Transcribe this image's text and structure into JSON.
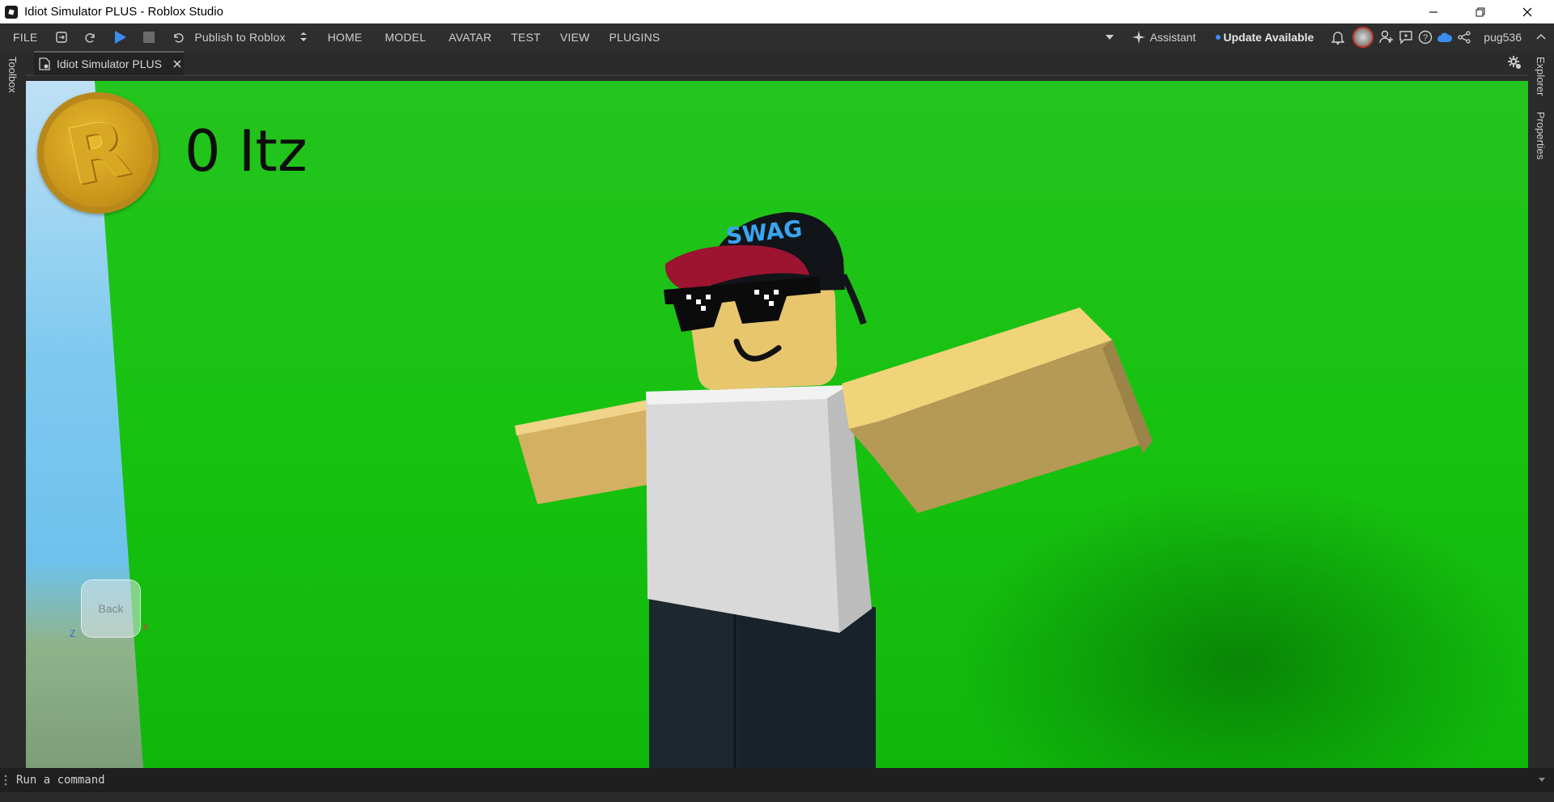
{
  "window": {
    "title": "Idiot Simulator PLUS - Roblox Studio",
    "controls": [
      "minimize",
      "restore",
      "close"
    ]
  },
  "menubar": {
    "file_label": "FILE",
    "publish_label": "Publish to Roblox",
    "tabs": [
      "HOME",
      "MODEL",
      "AVATAR",
      "TEST",
      "VIEW",
      "PLUGINS"
    ],
    "assistant_label": "Assistant",
    "update_label": "Update Available",
    "username": "pug536",
    "play_color": "#3b8df1"
  },
  "document_tab": {
    "label": "Idiot Simulator PLUS"
  },
  "side_panels": {
    "left": "Toolbox",
    "right": [
      "Explorer",
      "Properties"
    ]
  },
  "viewport": {
    "hud_coin_count": "0 Itz",
    "viewcube_label": "Back",
    "axis_z": "Z",
    "axis_x": "X",
    "hat_text": "SWAG",
    "colors": {
      "baseplate": "#16c10f",
      "skin": "#e7c66e",
      "shirt": "#d9d9d9",
      "pants": "#1c2730",
      "cap_brim": "#9c1430",
      "cap_top": "#111418",
      "coin": "#d4a420"
    }
  },
  "command_bar": {
    "placeholder": "Run a command"
  }
}
